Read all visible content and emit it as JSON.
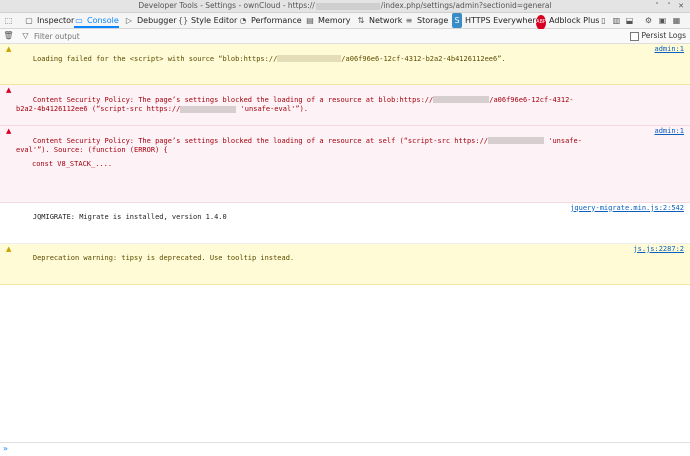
{
  "window": {
    "title_prefix": "Developer Tools - Settings - ownCloud - https://",
    "title_suffix": "/index.php/settings/admin?sectionid=general"
  },
  "toolbar": {
    "tabs": [
      {
        "label": "Inspector",
        "icon": "inspector-icon"
      },
      {
        "label": "Console",
        "icon": "console-icon"
      },
      {
        "label": "Debugger",
        "icon": "debugger-icon"
      },
      {
        "label": "Style Editor",
        "icon": "style-editor-icon"
      },
      {
        "label": "Performance",
        "icon": "performance-icon"
      },
      {
        "label": "Memory",
        "icon": "memory-icon"
      },
      {
        "label": "Network",
        "icon": "network-icon"
      },
      {
        "label": "Storage",
        "icon": "storage-icon"
      },
      {
        "label": "HTTPS Everywhere",
        "icon": "https-everywhere-icon"
      },
      {
        "label": "Adblock Plus",
        "icon": "adblock-plus-icon"
      }
    ],
    "active_tab": "Console"
  },
  "filter": {
    "placeholder": "Filter output",
    "persist_logs": "Persist Logs"
  },
  "messages": [
    {
      "type": "warning",
      "text_before": "Loading failed for the <script> with source “blob:https://",
      "text_after": "/a06f96e6-12cf-4312-b2a2-4b4126112ee6”.",
      "source": "admin:1"
    },
    {
      "type": "error",
      "text_before": "Content Security Policy: The page’s settings blocked the loading of a resource at blob:https://",
      "text_after": "/a06f96e6-12cf-4312-b2a2-4b4126112ee6 (“script-src https://",
      "text_after2": "'unsafe-eval'”).",
      "source": ""
    },
    {
      "type": "error",
      "text_before": "Content Security Policy: The page’s settings blocked the loading of a resource at self (“script-src https://",
      "text_after": "'unsafe-eval'”). Source: (function (ERROR) {",
      "stack": "const V8_STACK_....",
      "source": "admin:1"
    },
    {
      "type": "log",
      "text": "JQMIGRATE: Migrate is installed, version 1.4.0",
      "source": "jquery-migrate.min.js:2:542"
    },
    {
      "type": "warning",
      "text": "Deprecation warning: tipsy is deprecated. Use tooltip instead.",
      "source": "js.js:2287:2"
    }
  ],
  "colors": {
    "accent": "#0a84ff",
    "warning_bg": "#fffbd6",
    "error_bg": "#fdf2f5",
    "error_text": "#a4000f"
  }
}
